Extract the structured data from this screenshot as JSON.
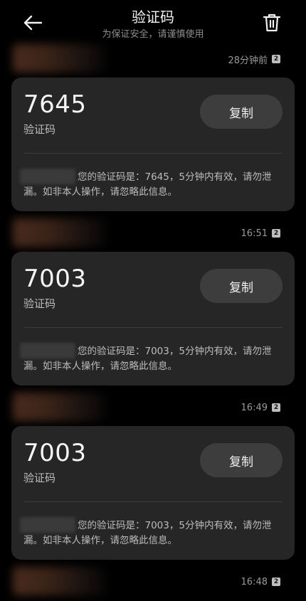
{
  "header": {
    "title": "验证码",
    "subtitle": "为保证安全，请谨慎使用"
  },
  "messages": [
    {
      "time": "28分钟前",
      "sim": "2",
      "code": "7645",
      "code_label": "验证码",
      "copy_label": "复制",
      "body": "您的验证码是：7645，5分钟内有效，请勿泄漏。如非本人操作，请忽略此信息。"
    },
    {
      "time": "16:51",
      "sim": "2",
      "code": "7003",
      "code_label": "验证码",
      "copy_label": "复制",
      "body": "您的验证码是：7003，5分钟内有效，请勿泄漏。如非本人操作，请忽略此信息。"
    },
    {
      "time": "16:49",
      "sim": "2",
      "code": "7003",
      "code_label": "验证码",
      "copy_label": "复制",
      "body": "您的验证码是：7003，5分钟内有效，请勿泄漏。如非本人操作，请忽略此信息。"
    },
    {
      "time": "16:48",
      "sim": "2"
    }
  ],
  "icons": {
    "back": "arrow-left-icon",
    "trash": "trash-icon"
  }
}
